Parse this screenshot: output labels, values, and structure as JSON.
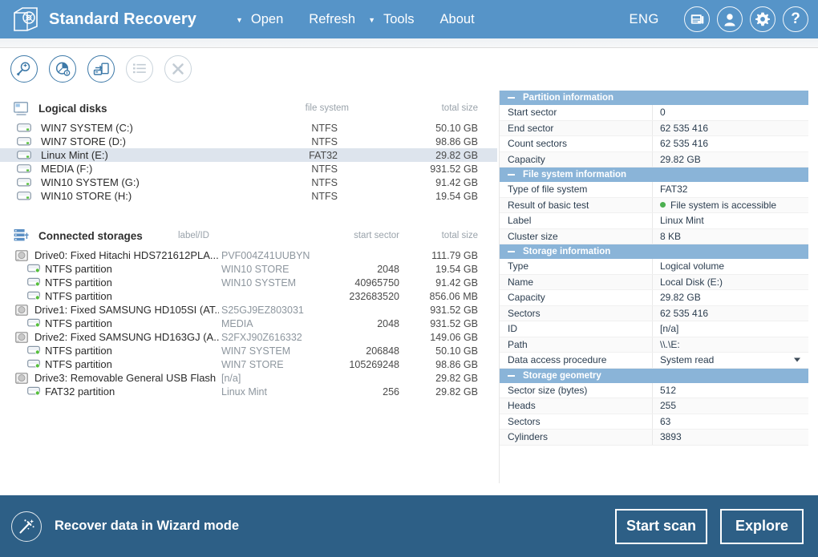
{
  "header": {
    "app_title": "Standard Recovery",
    "logo_icon": "folder-disk-logo-icon",
    "menu": [
      {
        "label": "Open",
        "has_caret": true,
        "icon": "chevron-down-icon"
      },
      {
        "label": "Refresh",
        "has_caret": false
      },
      {
        "label": "Tools",
        "has_caret": true,
        "icon": "chevron-down-icon"
      },
      {
        "label": "About",
        "has_caret": false
      }
    ],
    "language": "ENG",
    "buttons": [
      {
        "icon": "news-panel-icon"
      },
      {
        "icon": "user-account-icon"
      },
      {
        "icon": "gear-settings-icon"
      },
      {
        "icon": "help-question-icon",
        "glyph": "?"
      }
    ]
  },
  "toolbar": {
    "buttons": [
      {
        "icon": "magnifier-scan-icon",
        "enabled": true
      },
      {
        "icon": "pie-chart-analysis-icon",
        "enabled": true
      },
      {
        "icon": "disk-copy-transfer-icon",
        "enabled": true
      },
      {
        "icon": "list-view-icon",
        "enabled": false
      },
      {
        "icon": "close-x-icon",
        "enabled": false
      }
    ]
  },
  "logical_disks": {
    "title": "Logical disks",
    "icon": "monitor-logical-disks-icon",
    "columns": [
      "file system",
      "total size"
    ],
    "rows": [
      {
        "icon": "drive-icon",
        "name": "WIN7 SYSTEM (C:)",
        "file_system": "NTFS",
        "total_size": "50.10 GB",
        "selected": false
      },
      {
        "icon": "drive-icon",
        "name": "WIN7 STORE (D:)",
        "file_system": "NTFS",
        "total_size": "98.86 GB",
        "selected": false
      },
      {
        "icon": "drive-icon",
        "name": "Linux Mint (E:)",
        "file_system": "FAT32",
        "total_size": "29.82 GB",
        "selected": true
      },
      {
        "icon": "drive-icon",
        "name": "MEDIA (F:)",
        "file_system": "NTFS",
        "total_size": "931.52 GB",
        "selected": false
      },
      {
        "icon": "drive-icon",
        "name": "WIN10 SYSTEM (G:)",
        "file_system": "NTFS",
        "total_size": "91.42 GB",
        "selected": false
      },
      {
        "icon": "drive-icon",
        "name": "WIN10 STORE (H:)",
        "file_system": "NTFS",
        "total_size": "19.54 GB",
        "selected": false
      }
    ]
  },
  "connected_storages": {
    "title": "Connected storages",
    "icon": "storage-stack-icon",
    "columns": [
      "label/ID",
      "start sector",
      "total size"
    ],
    "rows": [
      {
        "icon": "physical-drive-icon",
        "level": 0,
        "name": "Drive0: Fixed Hitachi HDS721612PLA...",
        "label_id": "PVF004Z41UUBYN",
        "start_sector": "",
        "total_size": "111.79 GB"
      },
      {
        "icon": "partition-icon",
        "level": 1,
        "name": "NTFS partition",
        "label_id": "WIN10 STORE",
        "start_sector": "2048",
        "total_size": "19.54 GB"
      },
      {
        "icon": "partition-icon",
        "level": 1,
        "name": "NTFS partition",
        "label_id": "WIN10 SYSTEM",
        "start_sector": "40965750",
        "total_size": "91.42 GB"
      },
      {
        "icon": "partition-icon",
        "level": 1,
        "name": "NTFS partition",
        "label_id": "",
        "start_sector": "232683520",
        "total_size": "856.06 MB"
      },
      {
        "icon": "physical-drive-icon",
        "level": 0,
        "name": "Drive1: Fixed SAMSUNG HD105SI (AT...",
        "label_id": "S25GJ9EZ803031",
        "start_sector": "",
        "total_size": "931.52 GB"
      },
      {
        "icon": "partition-icon",
        "level": 1,
        "name": "NTFS partition",
        "label_id": "MEDIA",
        "start_sector": "2048",
        "total_size": "931.52 GB"
      },
      {
        "icon": "physical-drive-icon",
        "level": 0,
        "name": "Drive2: Fixed SAMSUNG HD163GJ (A...",
        "label_id": "S2FXJ90Z616332",
        "start_sector": "",
        "total_size": "149.06 GB"
      },
      {
        "icon": "partition-icon",
        "level": 1,
        "name": "NTFS partition",
        "label_id": "WIN7 SYSTEM",
        "start_sector": "206848",
        "total_size": "50.10 GB"
      },
      {
        "icon": "partition-icon",
        "level": 1,
        "name": "NTFS partition",
        "label_id": "WIN7 STORE",
        "start_sector": "105269248",
        "total_size": "98.86 GB"
      },
      {
        "icon": "physical-drive-icon",
        "level": 0,
        "name": "Drive3: Removable General USB Flash ...",
        "label_id": "[n/a]",
        "start_sector": "",
        "total_size": "29.82 GB"
      },
      {
        "icon": "partition-icon",
        "level": 1,
        "name": "FAT32 partition",
        "label_id": "Linux Mint",
        "start_sector": "256",
        "total_size": "29.82 GB"
      }
    ]
  },
  "info_panel": {
    "groups": [
      {
        "title": "Partition information",
        "collapse_icon": "minus-collapse-icon",
        "rows": [
          {
            "key": "Start sector",
            "value": "0"
          },
          {
            "key": "End sector",
            "value": "62 535 416"
          },
          {
            "key": "Count sectors",
            "value": "62 535 416"
          },
          {
            "key": "Capacity",
            "value": "29.82 GB"
          }
        ]
      },
      {
        "title": "File system information",
        "collapse_icon": "minus-collapse-icon",
        "rows": [
          {
            "key": "Type of file system",
            "value": "FAT32"
          },
          {
            "key": "Result of basic test",
            "value": "File system is accessible",
            "status_dot": "#4cb050"
          },
          {
            "key": "Label",
            "value": "Linux Mint"
          },
          {
            "key": "Cluster size",
            "value": "8 KB"
          }
        ]
      },
      {
        "title": "Storage information",
        "collapse_icon": "minus-collapse-icon",
        "rows": [
          {
            "key": "Type",
            "value": "Logical volume"
          },
          {
            "key": "Name",
            "value": "Local Disk (E:)"
          },
          {
            "key": "Capacity",
            "value": "29.82 GB"
          },
          {
            "key": "Sectors",
            "value": "62 535 416"
          },
          {
            "key": "ID",
            "value": "[n/a]"
          },
          {
            "key": "Path",
            "value": "\\\\.\\E:"
          },
          {
            "key": "Data access procedure",
            "value": "System read",
            "dropdown": true,
            "dropdown_icon": "chevron-down-icon"
          }
        ]
      },
      {
        "title": "Storage geometry",
        "collapse_icon": "minus-collapse-icon",
        "rows": [
          {
            "key": "Sector size (bytes)",
            "value": "512"
          },
          {
            "key": "Heads",
            "value": "255"
          },
          {
            "key": "Sectors",
            "value": "63"
          },
          {
            "key": "Cylinders",
            "value": "3893"
          }
        ]
      }
    ]
  },
  "footer": {
    "wizard_icon": "magic-wand-icon",
    "wizard_label": "Recover data in Wizard mode",
    "start_scan_label": "Start scan",
    "explore_label": "Explore"
  },
  "colors": {
    "header_blue": "#5694c8",
    "footer_blue": "#2d5f86",
    "group_header_blue": "#8ab4d8",
    "selection": "#dde4ed",
    "status_green": "#4cb050",
    "toolbar_icon": "#3d79a8"
  }
}
